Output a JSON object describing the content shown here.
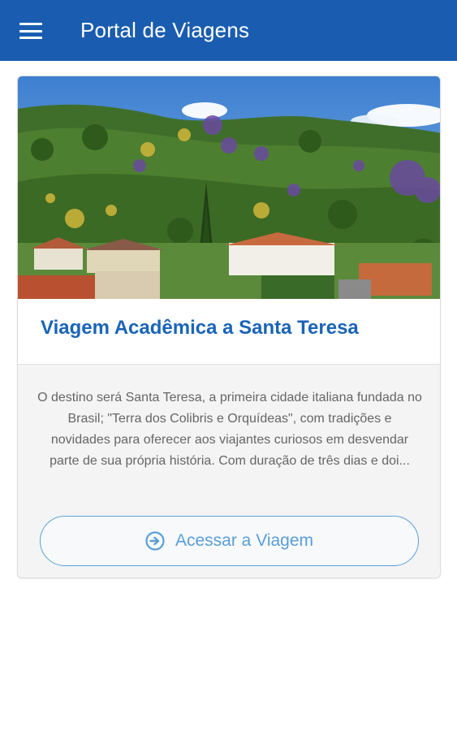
{
  "appbar": {
    "title": "Portal de Viagens",
    "menu_icon": "hamburger-menu-icon"
  },
  "card": {
    "title": "Viagem Acadêmica a Santa Teresa",
    "description": "O destino será Santa Teresa, a primeira cidade italiana fundada no Brasil; \"Terra dos Colibris e Orquídeas\", com tradições e novidades para oferecer aos viajantes curiosos em desvendar parte de sua própria história. Com duração de três dias e doi...",
    "button_label": "Acessar a Viagem",
    "button_icon": "arrow-circle-right-icon"
  },
  "colors": {
    "appbar": "#1a5db0",
    "title_accent": "#1a64b8",
    "button_accent": "#5a9ed8"
  }
}
